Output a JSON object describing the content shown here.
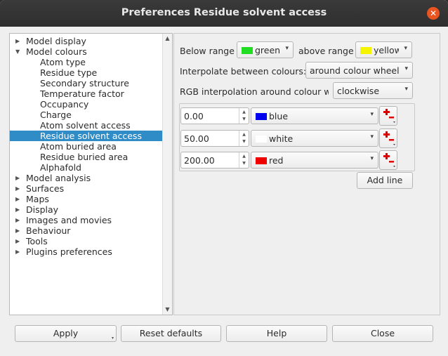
{
  "window": {
    "title": "Preferences  Residue solvent access",
    "close_glyph": "✕"
  },
  "tree": {
    "items": [
      {
        "label": "Model display",
        "level": 0,
        "expanded": false
      },
      {
        "label": "Model colours",
        "level": 0,
        "expanded": true
      },
      {
        "label": "Atom type",
        "level": 1
      },
      {
        "label": "Residue type",
        "level": 1
      },
      {
        "label": "Secondary structure",
        "level": 1
      },
      {
        "label": "Temperature factor",
        "level": 1
      },
      {
        "label": "Occupancy",
        "level": 1
      },
      {
        "label": "Charge",
        "level": 1
      },
      {
        "label": "Atom solvent access",
        "level": 1
      },
      {
        "label": "Residue solvent access",
        "level": 1,
        "selected": true
      },
      {
        "label": "Atom buried area",
        "level": 1
      },
      {
        "label": "Residue buried area",
        "level": 1
      },
      {
        "label": "Alphafold",
        "level": 1
      },
      {
        "label": "Model analysis",
        "level": 0,
        "expanded": false
      },
      {
        "label": "Surfaces",
        "level": 0,
        "expanded": false
      },
      {
        "label": "Maps",
        "level": 0,
        "expanded": false
      },
      {
        "label": "Display",
        "level": 0,
        "expanded": false
      },
      {
        "label": "Images and movies",
        "level": 0,
        "expanded": false
      },
      {
        "label": "Behaviour",
        "level": 0,
        "expanded": false
      },
      {
        "label": "Tools",
        "level": 0,
        "expanded": false
      },
      {
        "label": "Plugins preferences",
        "level": 0,
        "expanded": false
      }
    ],
    "arrow_collapsed": "▶",
    "arrow_expanded": "▼",
    "scroll_up": "▲",
    "scroll_down": "▼"
  },
  "settings": {
    "below_range_label": "Below range",
    "below_range_value": "green",
    "below_range_color": "#22dd22",
    "above_range_label": "above range",
    "above_range_value": "yellow",
    "above_range_color": "#f5f500",
    "interpolate_label": "Interpolate between colours:",
    "interpolate_value": "around colour wheel",
    "rgb_label": "RGB interpolation around colour wh",
    "rgb_value": "clockwise",
    "caret": "▾"
  },
  "color_stops": [
    {
      "value": "0.00",
      "color_name": "blue",
      "color_hex": "#0000ee"
    },
    {
      "value": "50.00",
      "color_name": "white",
      "color_hex": "#ffffff"
    },
    {
      "value": "200.00",
      "color_name": "red",
      "color_hex": "#ee0000"
    }
  ],
  "add_line_label": "Add line",
  "buttons": {
    "apply": "Apply",
    "reset": "Reset defaults",
    "help": "Help",
    "close": "Close"
  },
  "colors": {
    "selection": "#308cc6",
    "close_button": "#e95420",
    "plus_red": "#dd0000"
  }
}
